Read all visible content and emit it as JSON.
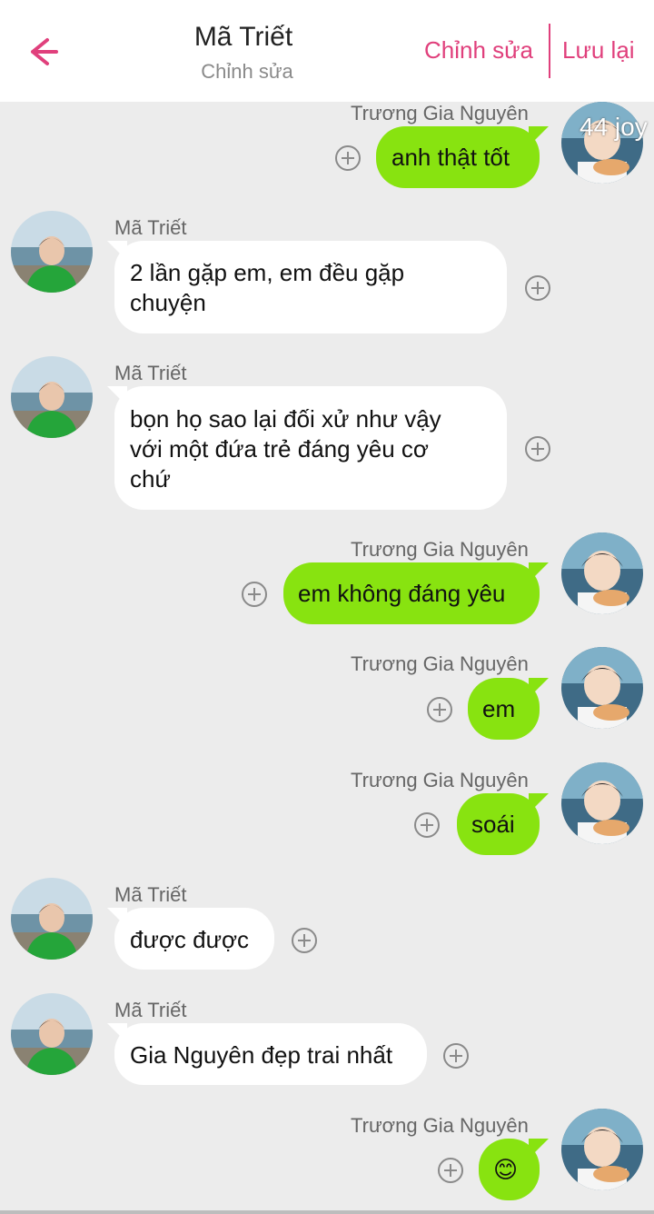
{
  "header": {
    "title": "Mã Triết",
    "subtitle": "Chỉnh sửa",
    "edit_label": "Chỉnh sửa",
    "save_label": "Lưu lại",
    "accent": "#e0407c"
  },
  "overlay_text": "44 joy",
  "colors": {
    "left_bubble": "#ffffff",
    "right_bubble": "#88e310",
    "background": "#ececec"
  },
  "messages": [
    {
      "sender": "Trương Gia Nguyên",
      "side": "right",
      "text": "anh thật tốt"
    },
    {
      "sender": "Mã Triết",
      "side": "left",
      "lines": [
        "2 lần gặp em, em đều gặp",
        "chuyện"
      ]
    },
    {
      "sender": "Mã Triết",
      "side": "left",
      "lines": [
        "bọn họ sao lại đối xử như vậy",
        "với một đứa trẻ đáng yêu cơ",
        "chứ"
      ]
    },
    {
      "sender": "Trương Gia Nguyên",
      "side": "right",
      "text": "em không đáng yêu"
    },
    {
      "sender": "Trương Gia Nguyên",
      "side": "right",
      "text": "em"
    },
    {
      "sender": "Trương Gia Nguyên",
      "side": "right",
      "text": "soái"
    },
    {
      "sender": "Mã Triết",
      "side": "left",
      "text": "được được"
    },
    {
      "sender": "Mã Triết",
      "side": "left",
      "text": "Gia Nguyên đẹp trai nhất"
    },
    {
      "sender": "Trương Gia Nguyên",
      "side": "right",
      "text": "😊"
    }
  ]
}
